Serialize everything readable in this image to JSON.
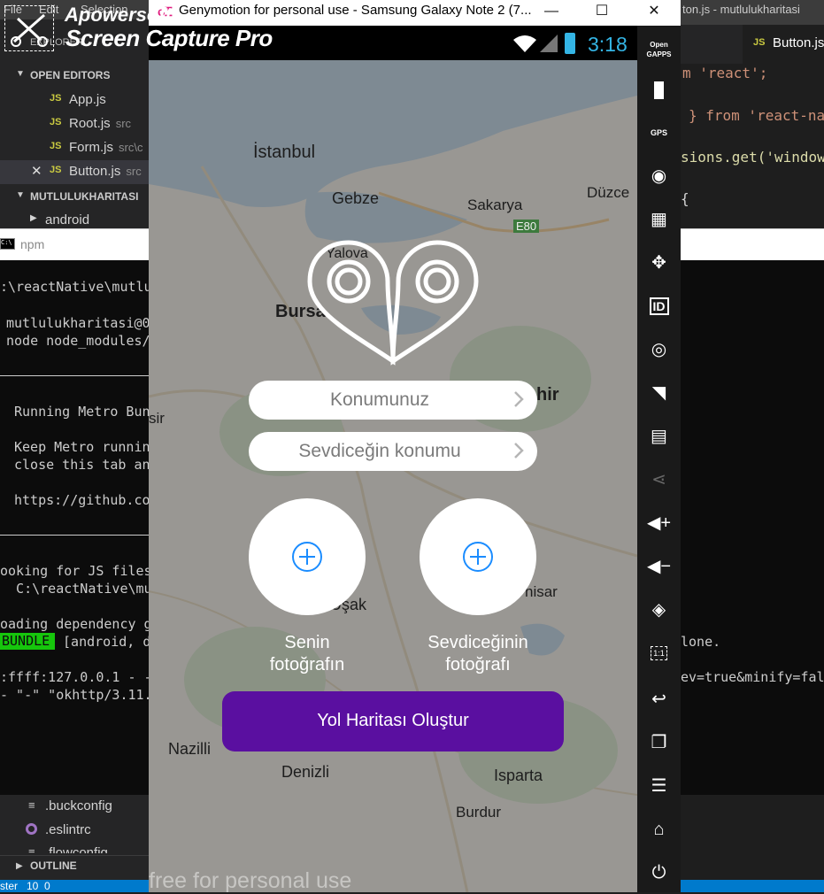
{
  "vscode": {
    "menu": [
      "File",
      "Edit",
      "Selection"
    ],
    "explorer_label": "EXPLORER",
    "open_editors_label": "OPEN EDITORS",
    "files": [
      {
        "name": "App.js",
        "dir": ""
      },
      {
        "name": "Root.js",
        "dir": "src"
      },
      {
        "name": "Form.js",
        "dir": "src\\c"
      },
      {
        "name": "Button.js",
        "dir": "src"
      }
    ],
    "project_label": "MUTLULUKHARITASI",
    "folder_android": "android",
    "right_title": "ton.js - mutlulukharitasi",
    "right_tab": "Button.js",
    "code_lines": [
      "m 'react';",
      "} from 'react-na",
      "sions.get('window",
      "{"
    ],
    "bottom_files": [
      ".buckconfig",
      ".eslintrc",
      ".flowconfig"
    ],
    "outline_label": "OUTLINE",
    "status": "ster   10  0"
  },
  "terminal": {
    "title": "npm",
    "lines": [
      ":\\reactNative\\mutlu",
      "mutlulukharitasi@0",
      "node node_modules/",
      "Running Metro Bun",
      "Keep Metro runnin",
      "close this tab an",
      "https://github.co",
      "ooking for JS files",
      "  C:\\reactNative\\mu",
      "oading dependency g",
      ":ffff:127.0.0.1 - -",
      "- \"-\" \"okhttp/3.11."
    ],
    "bundle_badge": "BUNDLE",
    "bundle_line": " [android, d",
    "right_done": "lone.",
    "right_url": "ev=true&minify=fals"
  },
  "genymotion": {
    "title": "Genymotion for personal use - Samsung Galaxy Note 2 (7...",
    "minimize": "—",
    "maximize": "☐",
    "close": "✕",
    "side_labels": {
      "opengapps": "Open GAPPS",
      "gps": "GPS",
      "id": "ID",
      "scale": "1:1"
    },
    "watermark": "free for personal use"
  },
  "phone": {
    "clock": "3:18",
    "map_labels": [
      "İstanbul",
      "Gebze",
      "Sakarya",
      "Düzce",
      "E80",
      "Yalova",
      "Bursa",
      "hir",
      "sir",
      "Uşak",
      "hisar",
      "Nazilli",
      "Denizli",
      "Isparta",
      "Burdur"
    ],
    "location_field": "Konumunuz",
    "beloved_location_field": "Sevdiceğin konumu",
    "your_photo_label": "Senin fotoğrafın",
    "beloved_photo_label": "Sevdiceğinin fotoğrafı",
    "create_route_button": "Yol Haritası Oluştur"
  },
  "capture_overlay": {
    "brand": "Apowersoft",
    "product": "Screen Capture Pro"
  },
  "colors": {
    "accent_purple": "#5a0fa0",
    "plus_blue": "#1a8cff",
    "clock_blue": "#34b5e5",
    "map_overlay": "rgba(90,90,90,0.55)"
  }
}
